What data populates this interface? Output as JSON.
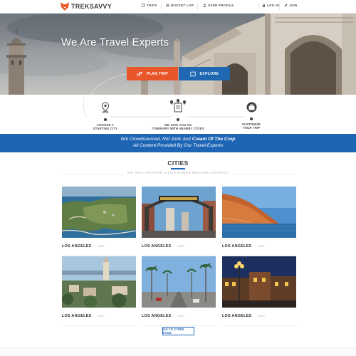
{
  "brand": {
    "name": "TREKSAVVY",
    "accent": "#e8562a",
    "primary": "#1e66b5"
  },
  "nav": {
    "items": [
      {
        "label": "TRIPS",
        "icon": "map-icon"
      },
      {
        "label": "BUCKET LIST",
        "icon": "list-icon"
      },
      {
        "label": "USER PROFILE",
        "icon": "user-icon"
      },
      {
        "label": "LOG IN",
        "icon": "lock-icon"
      },
      {
        "label": "JOIN",
        "icon": "pencil-icon"
      }
    ]
  },
  "hero": {
    "title": "We Are Travel Experts",
    "plan_button": "PLAN TRIP",
    "explore_button": "EXPLORE"
  },
  "steps": [
    {
      "line1": "CHOOSE A",
      "line2": "STARTING CITY",
      "icon": "map-pin-icon"
    },
    {
      "line1": "WE GIVE YOU AN",
      "line2": "ITINERARY WITH NEARBY CITIES",
      "icon": "itinerary-icon"
    },
    {
      "line1": "CUSTOMIZE",
      "line2": "YOUR TRIP",
      "icon": "suitcase-icon"
    }
  ],
  "banner": {
    "line1_prefix": "Not Crowdsourced, Not Junk Just ",
    "line1_bold": "Cream Of The Crop",
    "line2": "All Content Provided By Our Travel Experts"
  },
  "cities": {
    "title": "CITIES",
    "subtitle": "WE ONLY FEATURE CITIES WHERE WE HAVE EXPERTS!",
    "cards": [
      {
        "name": "LOS ANGELES",
        "country": "USA"
      },
      {
        "name": "LOS ANGELES",
        "country": "USA"
      },
      {
        "name": "LOS ANGELES",
        "country": "USA"
      },
      {
        "name": "LOS ANGELES",
        "country": "USA"
      },
      {
        "name": "LOS ANGELES",
        "country": "USA"
      },
      {
        "name": "LOS ANGELES",
        "country": "USA"
      }
    ],
    "button": "GO TO CITIES PAGE"
  }
}
